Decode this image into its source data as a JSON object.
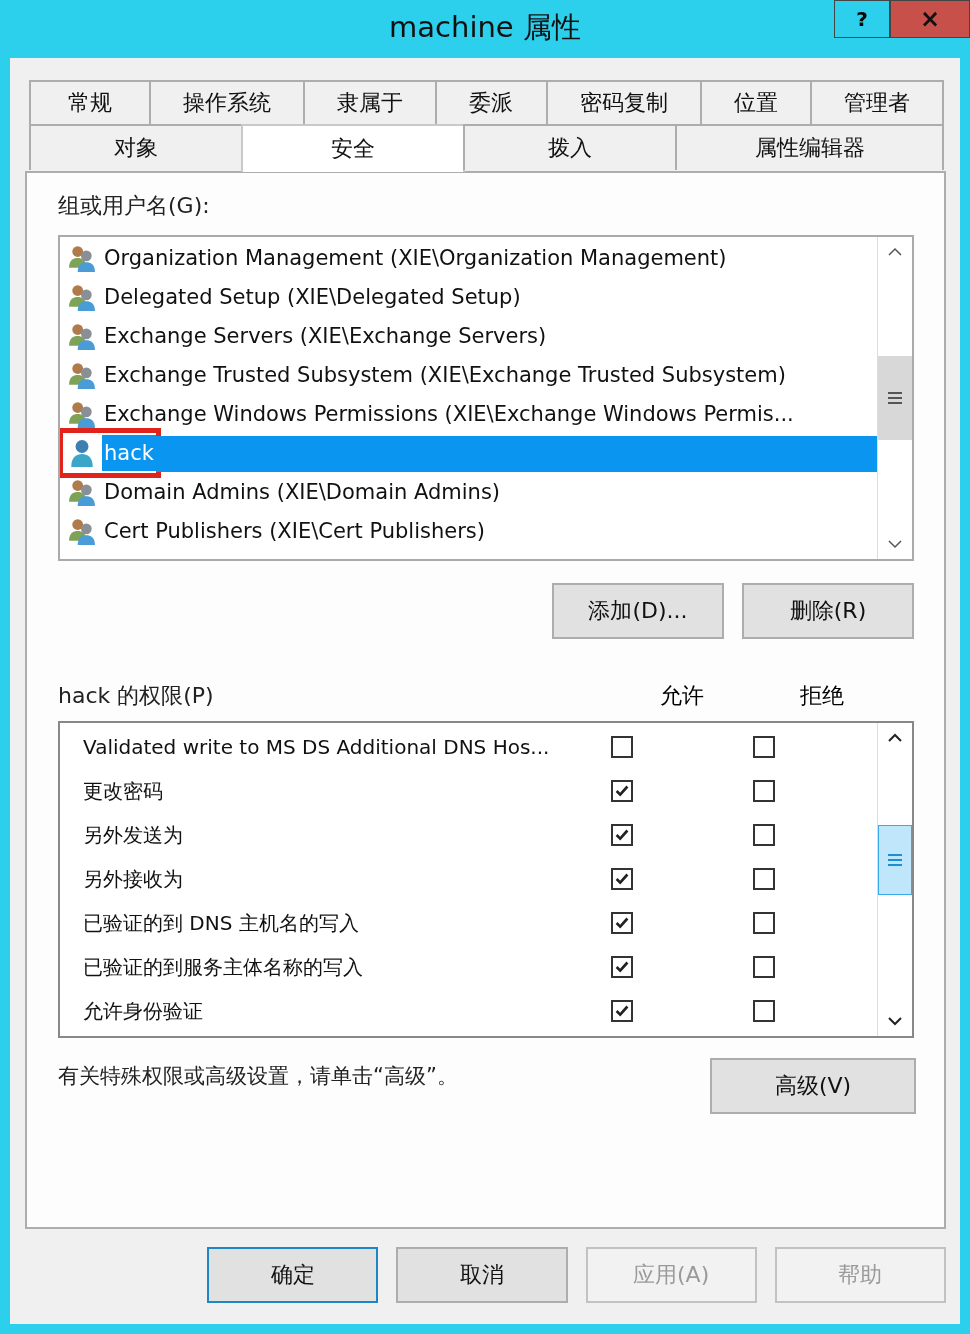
{
  "window": {
    "title": "machine 属性",
    "help_button": "?",
    "close_button": "×"
  },
  "tab_rows": [
    [
      {
        "label": "常规",
        "selected": false
      },
      {
        "label": "操作系统",
        "selected": false
      },
      {
        "label": "隶属于",
        "selected": false
      },
      {
        "label": "委派",
        "selected": false
      },
      {
        "label": "密码复制",
        "selected": false
      },
      {
        "label": "位置",
        "selected": false
      },
      {
        "label": "管理者",
        "selected": false
      }
    ],
    [
      {
        "label": "对象",
        "selected": false
      },
      {
        "label": "安全",
        "selected": true
      },
      {
        "label": "拨入",
        "selected": false
      },
      {
        "label": "属性编辑器",
        "selected": false
      }
    ]
  ],
  "groups": {
    "label": "组或用户名(G):",
    "items": [
      {
        "name": "Organization Management (XIE\\Organization Management)",
        "kind": "group",
        "selected": false,
        "highlighted": false
      },
      {
        "name": "Delegated Setup (XIE\\Delegated Setup)",
        "kind": "group",
        "selected": false,
        "highlighted": false
      },
      {
        "name": "Exchange Servers (XIE\\Exchange Servers)",
        "kind": "group",
        "selected": false,
        "highlighted": false
      },
      {
        "name": "Exchange Trusted Subsystem (XIE\\Exchange Trusted Subsystem)",
        "kind": "group",
        "selected": false,
        "highlighted": false
      },
      {
        "name": "Exchange Windows Permissions (XIE\\Exchange Windows Permis...",
        "kind": "group",
        "selected": false,
        "highlighted": false
      },
      {
        "name": "hack",
        "kind": "user",
        "selected": true,
        "highlighted": true
      },
      {
        "name": "Domain Admins (XIE\\Domain Admins)",
        "kind": "group",
        "selected": false,
        "highlighted": false
      },
      {
        "name": "Cert Publishers (XIE\\Cert Publishers)",
        "kind": "group",
        "selected": false,
        "highlighted": false
      }
    ],
    "buttons": [
      {
        "label": "添加(D)..."
      },
      {
        "label": "删除(R)"
      }
    ]
  },
  "permissions": {
    "label": "hack 的权限(P)",
    "allow_header": "允许",
    "deny_header": "拒绝",
    "rows": [
      {
        "name": "Validated write to MS DS Additional DNS Hos...",
        "allow": false,
        "deny": false
      },
      {
        "name": "更改密码",
        "allow": true,
        "deny": false
      },
      {
        "name": "另外发送为",
        "allow": true,
        "deny": false
      },
      {
        "name": "另外接收为",
        "allow": true,
        "deny": false
      },
      {
        "name": "已验证的到 DNS 主机名的写入",
        "allow": true,
        "deny": false
      },
      {
        "name": "已验证的到服务主体名称的写入",
        "allow": true,
        "deny": false
      },
      {
        "name": "允许身份验证",
        "allow": true,
        "deny": false
      }
    ]
  },
  "advanced": {
    "note": "有关特殊权限或高级设置，请单击“高级”。",
    "button": "高级(V)"
  },
  "footer_buttons": [
    {
      "label": "确定",
      "default": true,
      "disabled": false
    },
    {
      "label": "取消",
      "default": false,
      "disabled": false
    },
    {
      "label": "应用(A)",
      "default": false,
      "disabled": true
    },
    {
      "label": "帮助",
      "default": false,
      "disabled": true
    }
  ]
}
